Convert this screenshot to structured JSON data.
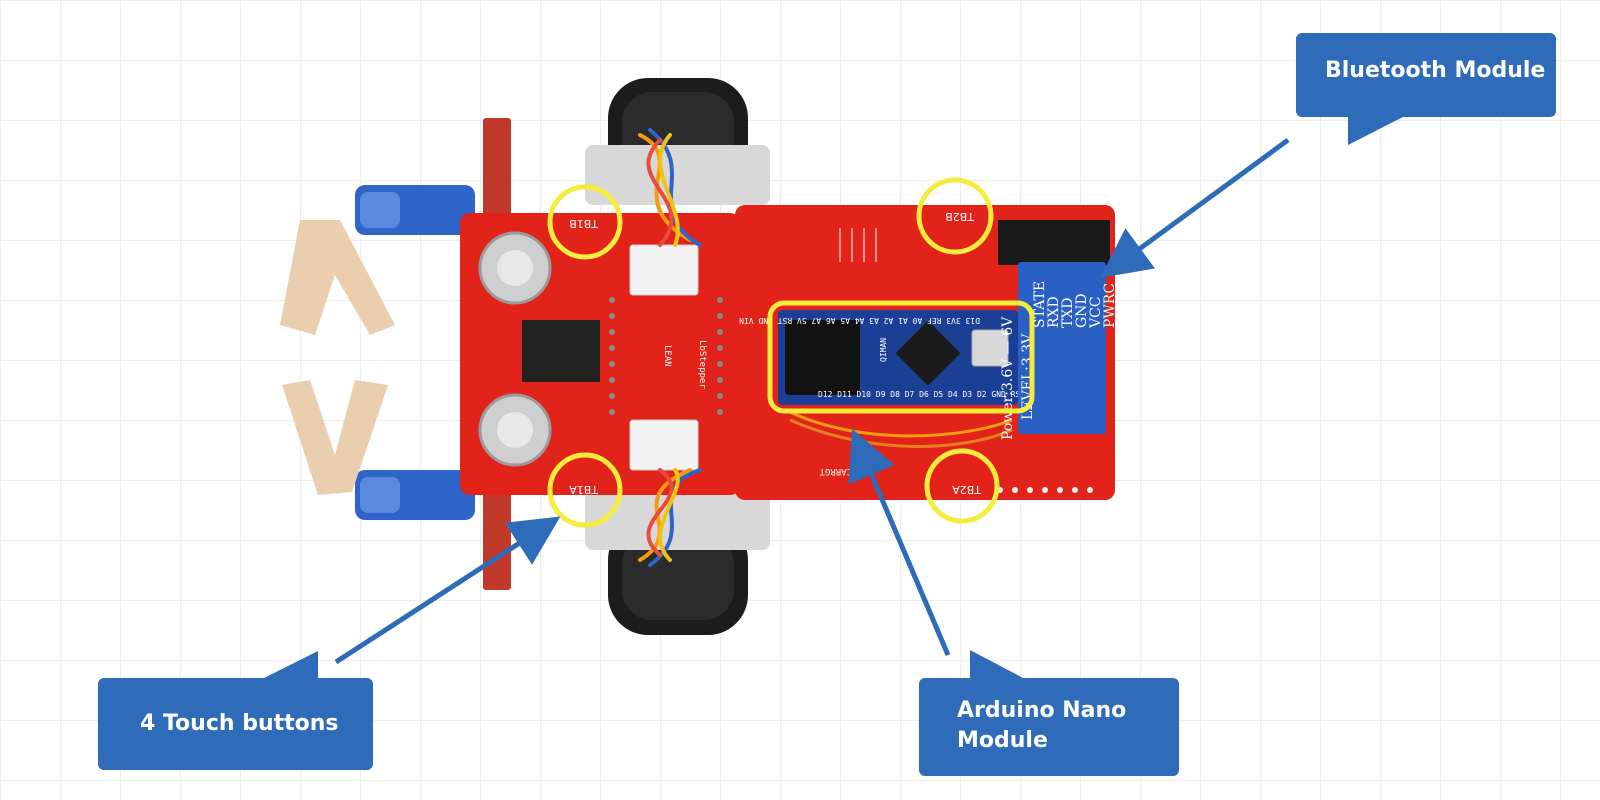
{
  "callouts": {
    "bluetooth": "Bluetooth Module",
    "touch": "4 Touch buttons",
    "nano_line1": "Arduino Nano",
    "nano_line2": "Module"
  },
  "board": {
    "touch_labels": [
      "TB1B",
      "TB2B",
      "TB1A",
      "TB2A"
    ],
    "brand": "LEAN",
    "model": "LbStepper",
    "brand_small": "CARRGT"
  },
  "bluetooth_module": {
    "pins": [
      "STATE",
      "RXD",
      "TXD",
      "GND",
      "VCC",
      "PWRC"
    ],
    "level": "LEVEL:3.3V",
    "power": "Power:3.6V — 6V"
  },
  "nano": {
    "top_pins": "D13 3V3 REF A0 A1 A2 A3 A4 A5 A6 A7 5V RST GND VIN",
    "bottom_pins": "D12 D11 D10 D9 D8 D7 D6 D5 D4 D3 D2 GND RST RX0 TX1",
    "chip_label": "QIMAN"
  },
  "colors": {
    "callout": "#2e6bb8",
    "arrow": "#2e6bb8",
    "highlight": "#f5ec3c",
    "pcb": "#e2231a",
    "nano_pcb": "#1b3f95",
    "bt_pcb": "#2a5fc4"
  }
}
